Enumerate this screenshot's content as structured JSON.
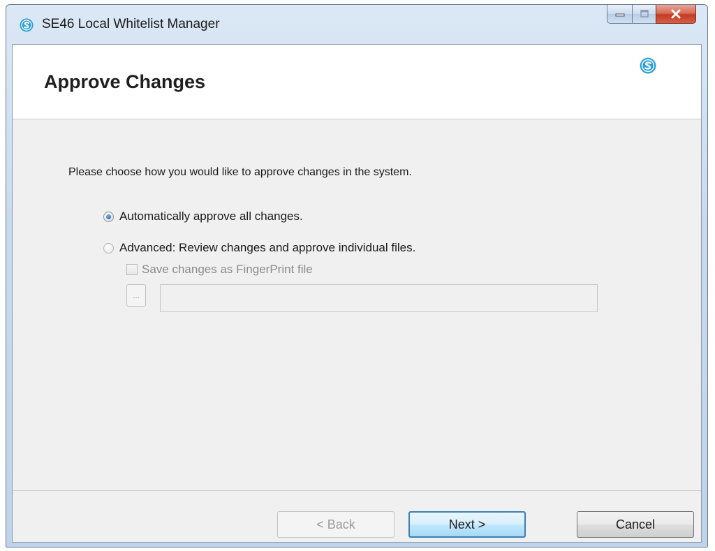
{
  "window": {
    "title": "SE46 Local Whitelist Manager",
    "icon": "app-logo-icon"
  },
  "caption_buttons": {
    "minimize_icon": "minimize-icon",
    "maximize_icon": "maximize-icon",
    "close_label": "X"
  },
  "header": {
    "title": "Approve Changes",
    "logo_icon": "app-logo-icon"
  },
  "content": {
    "instruction": "Please choose how you would like to approve changes in the system.",
    "options": [
      {
        "label": "Automatically approve all changes.",
        "checked": true
      },
      {
        "label": "Advanced: Review changes and approve individual files.",
        "checked": false
      }
    ],
    "save_fingerprint": {
      "label": "Save changes as FingerPrint file",
      "checked": false,
      "enabled": false
    },
    "browse_button_label": "...",
    "file_path_value": ""
  },
  "footer": {
    "back_label": "< Back",
    "next_label": "Next >",
    "cancel_label": "Cancel"
  },
  "colors": {
    "accent": "#3c7fb1",
    "logo": "#2a9fd6"
  }
}
